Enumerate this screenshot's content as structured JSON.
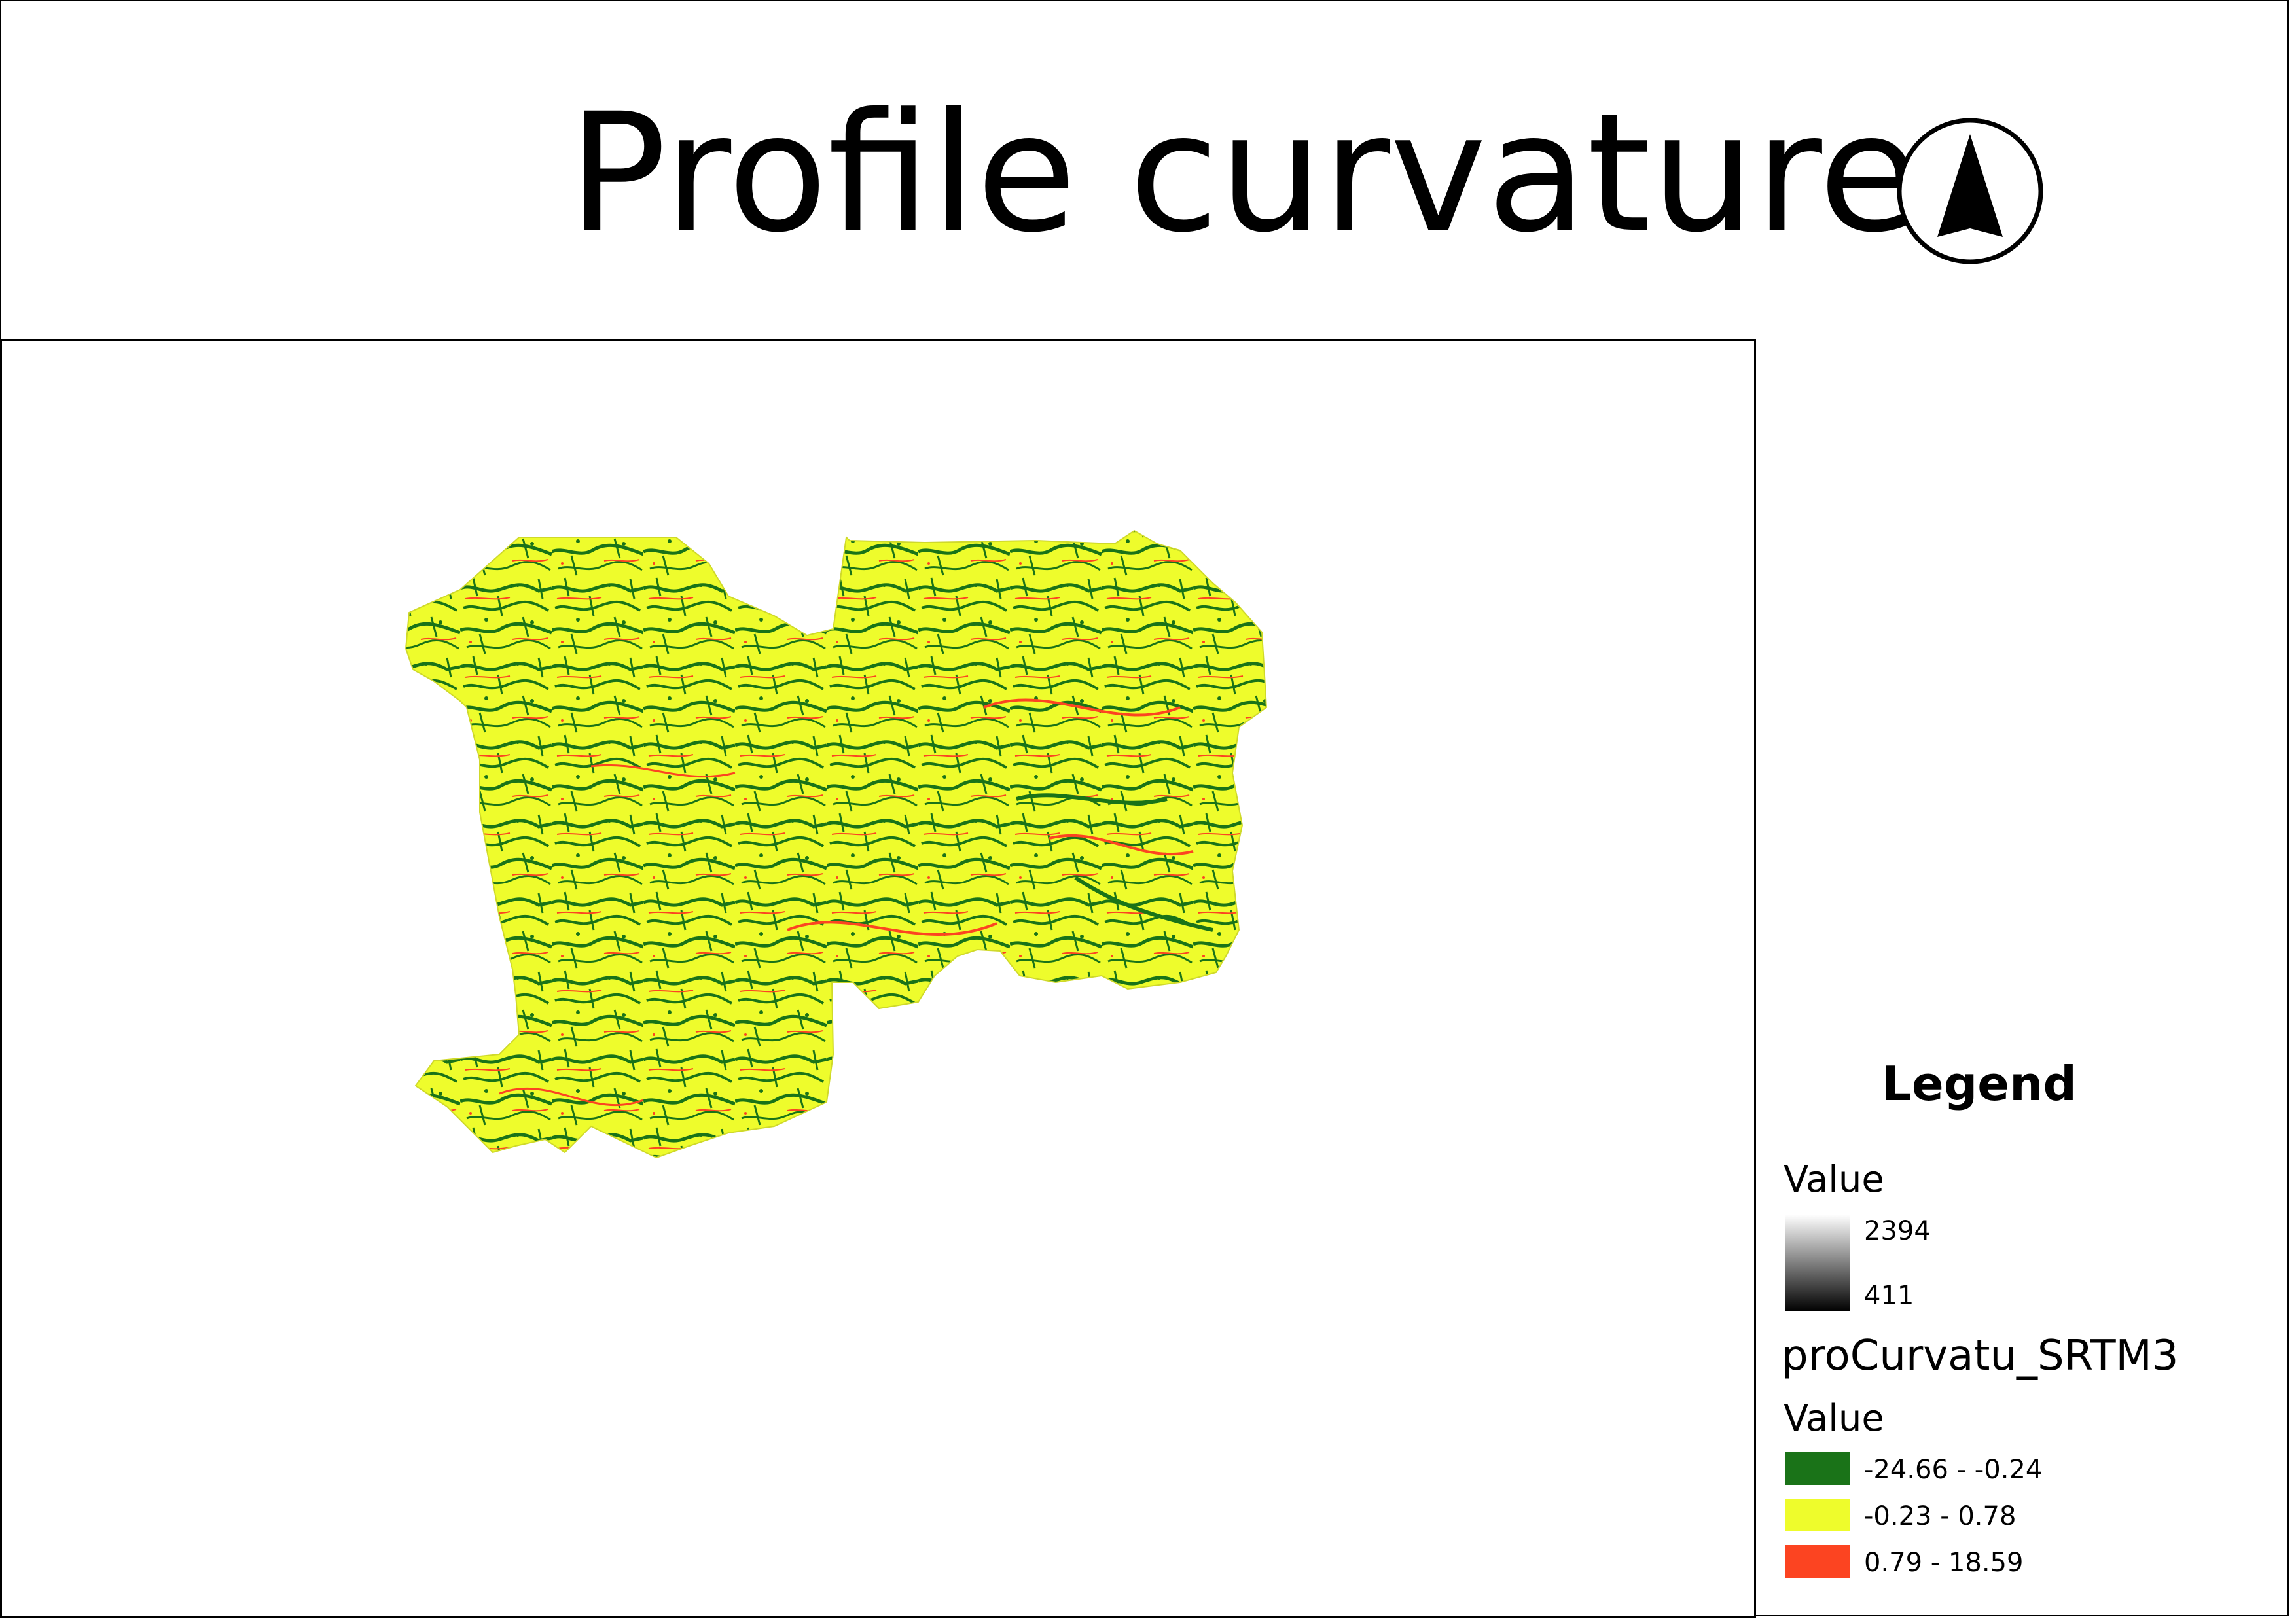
{
  "title": "Profile curvature",
  "north_arrow": {
    "icon": "north-arrow-icon"
  },
  "legend": {
    "title": "Legend",
    "dem": {
      "header": "Value",
      "high": "2394",
      "low": "411"
    },
    "layer_name": "proCurvatu_SRTM3",
    "classes_header": "Value",
    "classes": [
      {
        "label": "-24.66 - -0.24",
        "color": "#1a7318"
      },
      {
        "label": "-0.23 - 0.78",
        "color": "#eefc2c"
      },
      {
        "label": "0.79 - 18.59",
        "color": "#fc4421"
      }
    ]
  }
}
